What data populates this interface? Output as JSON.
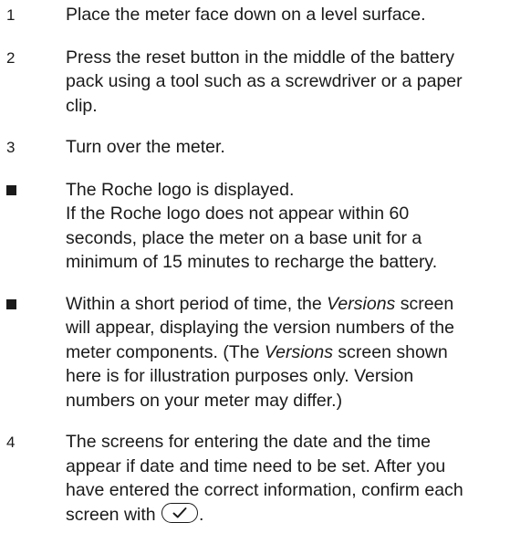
{
  "steps": [
    {
      "marker": "1",
      "lines": [
        "Place the meter face down on a level surface."
      ]
    },
    {
      "marker": "2",
      "lines": [
        "Press the reset button in the middle of the battery",
        "pack using a tool such as a screwdriver or a paper",
        "clip."
      ]
    },
    {
      "marker": "3",
      "lines": [
        "Turn over the meter."
      ]
    },
    {
      "marker": "bullet",
      "lines": [
        "The Roche logo is displayed.",
        "If the Roche logo does not appear within 60",
        "seconds, place the meter on a base unit for a",
        "minimum of 15 minutes to recharge the battery."
      ]
    },
    {
      "marker": "bullet",
      "line1_pre": "Within a short period of time, the ",
      "line1_em": "Versions",
      "line1_post": " screen",
      "line2": "will appear, displaying the version numbers of the",
      "line3_pre": "meter components. (The ",
      "line3_em": "Versions",
      "line3_post": " screen shown",
      "line4": "here is for illustration purposes only. Version",
      "line5": "numbers on your meter may differ.)"
    },
    {
      "marker": "4",
      "lines": [
        "The screens for entering the date and the time",
        "appear if date and time need to be set. After you",
        "have entered the correct information, confirm each"
      ],
      "last_pre": "screen with ",
      "last_post": ".",
      "button_icon": "checkmark-icon"
    }
  ]
}
